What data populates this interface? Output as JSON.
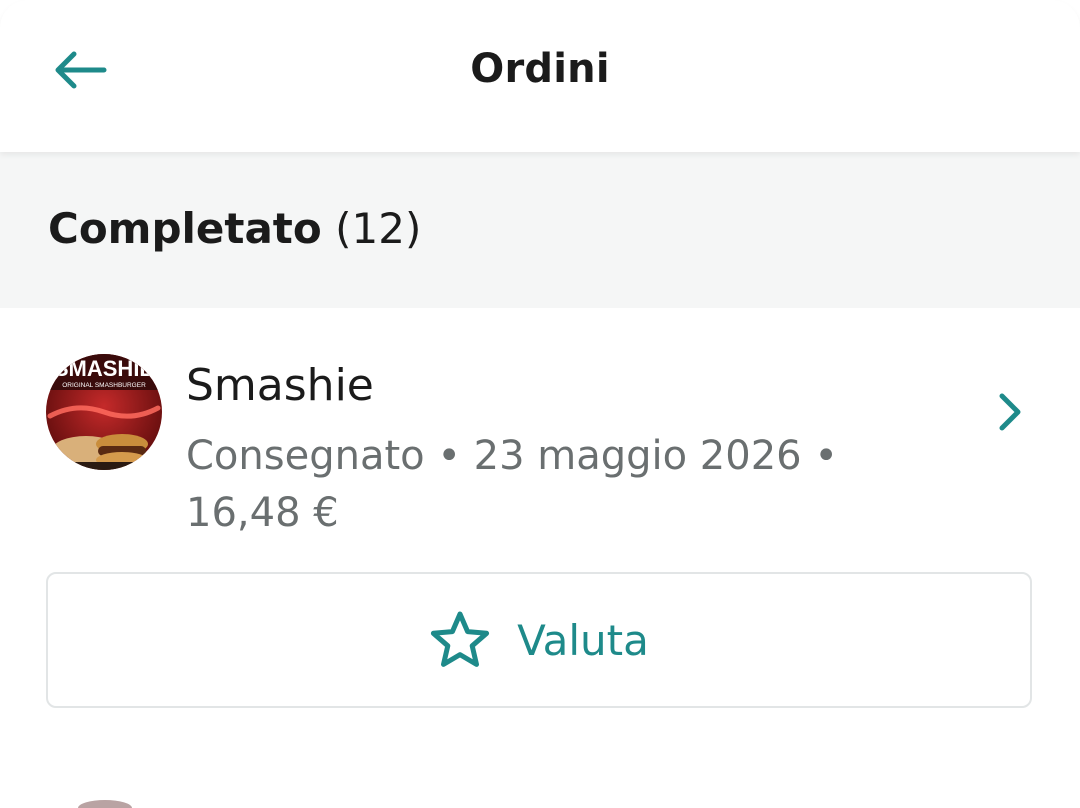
{
  "header": {
    "title": "Ordini",
    "back_icon": "arrow-left-icon"
  },
  "section": {
    "title": "Completato",
    "count": "(12)"
  },
  "orders": [
    {
      "restaurant": "Smashie",
      "avatar_text_top": "SMASHIE",
      "avatar_text_sub": "ORIGINAL SMASHBURGER",
      "meta": "Consegnato • 23 maggio 2026 • 16,48 €",
      "chevron_icon": "chevron-right-icon",
      "rate_label": "Valuta",
      "rate_icon": "star-outline-icon"
    }
  ],
  "colors": {
    "accent": "#1e8a8a",
    "section_bg": "#f5f6f6",
    "muted_text": "#6a6f70",
    "border": "#e2e5e6"
  }
}
